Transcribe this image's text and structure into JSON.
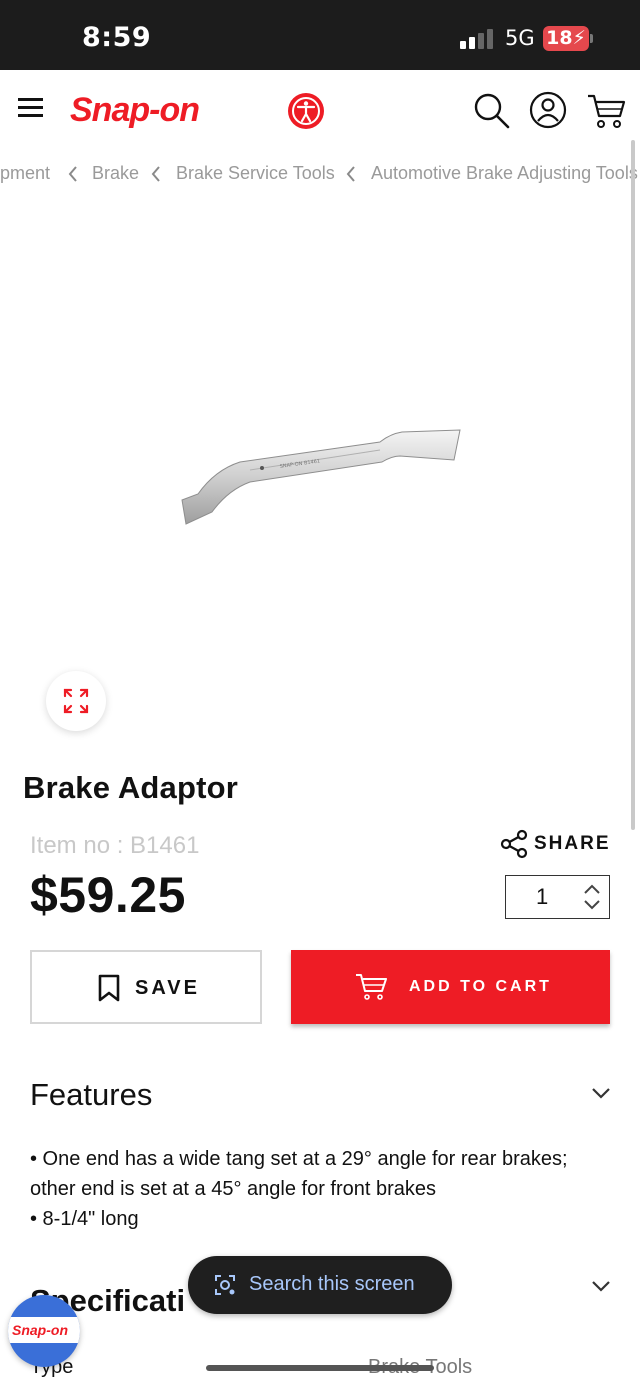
{
  "status_bar": {
    "time": "8:59",
    "network": "5G",
    "battery": "18"
  },
  "header": {
    "logo_text": "Snap-on"
  },
  "breadcrumb": {
    "items": [
      "pment",
      "Brake",
      "Brake Service Tools",
      "Automotive Brake Adjusting Tools"
    ]
  },
  "product": {
    "title": "Brake Adaptor",
    "item_no": "Item no : B1461",
    "price": "$59.25",
    "quantity": "1"
  },
  "actions": {
    "share_label": "SHARE",
    "save_label": "SAVE",
    "add_to_cart_label": "ADD TO CART"
  },
  "features": {
    "heading": "Features",
    "lines": [
      "• One end has a wide tang set at a 29° angle for rear brakes;",
      "other end is set at a 45° angle for front brakes",
      "• 8-1/4\" long"
    ]
  },
  "specifications": {
    "heading": "Specificati",
    "rows": [
      {
        "label": "Type",
        "value": "Brake Tools"
      }
    ]
  },
  "overlay": {
    "search_label": "Search this screen",
    "badge_text": "Snap-on"
  },
  "colors": {
    "brand_red": "#ee1c25",
    "muted_text": "#9a9a9a",
    "pill_text": "#a8c7fa"
  }
}
